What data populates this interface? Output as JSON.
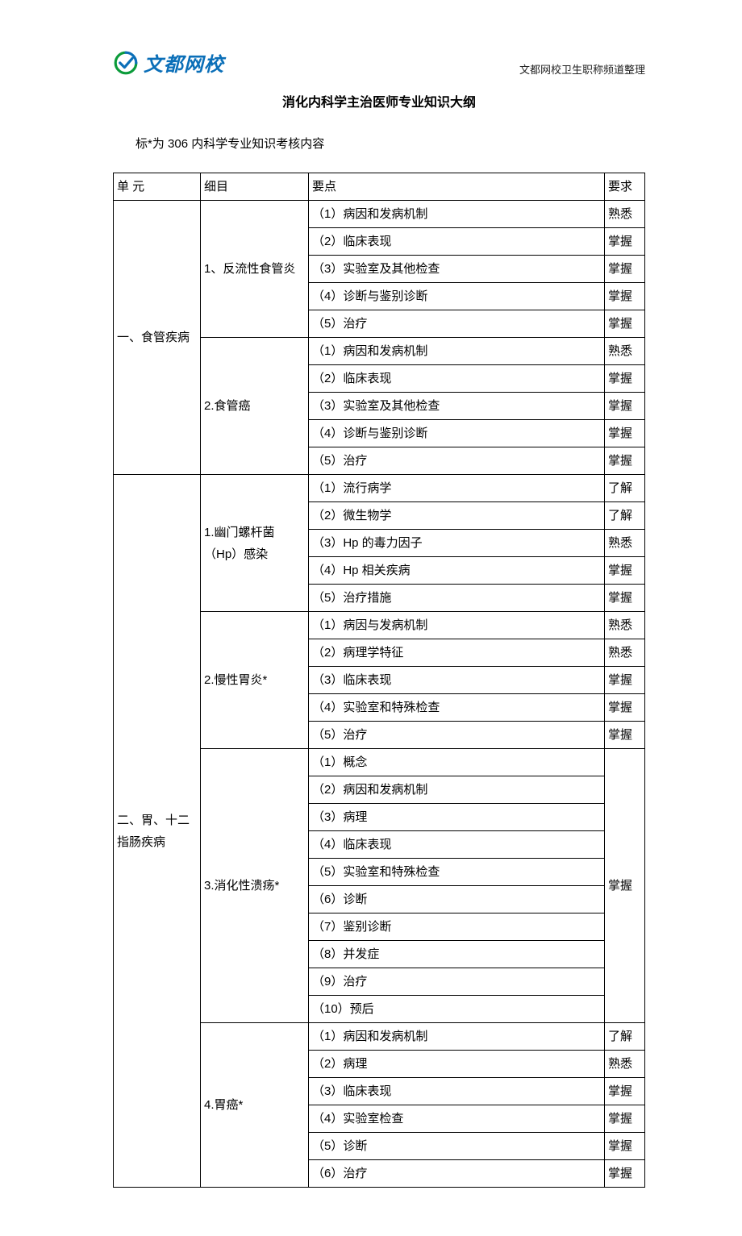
{
  "header_right": "文都网校卫生职称频道整理",
  "logo_text": "文都网校",
  "title": "消化内科学主治医师专业知识大纲",
  "note": "标*为 306 内科学专业知识考核内容",
  "columns": {
    "unit": "单 元",
    "detail": "细目",
    "point": "要点",
    "req": "要求"
  },
  "units": [
    {
      "name": "一、食管疾病",
      "details": [
        {
          "name": "1、反流性食管炎",
          "points": [
            {
              "text": "（1）病因和发病机制",
              "req": "熟悉"
            },
            {
              "text": "（2）临床表现",
              "req": "掌握"
            },
            {
              "text": "（3）实验室及其他检查",
              "req": "掌握"
            },
            {
              "text": "（4）诊断与鉴别诊断",
              "req": "掌握"
            },
            {
              "text": "（5）治疗",
              "req": "掌握"
            }
          ]
        },
        {
          "name": "2.食管癌",
          "points": [
            {
              "text": "（1）病因和发病机制",
              "req": "熟悉"
            },
            {
              "text": "（2）临床表现",
              "req": "掌握"
            },
            {
              "text": "（3）实验室及其他检查",
              "req": "掌握"
            },
            {
              "text": "（4）诊断与鉴别诊断",
              "req": "掌握"
            },
            {
              "text": "（5）治疗",
              "req": "掌握"
            }
          ]
        }
      ]
    },
    {
      "name": "二、胃、十二指肠疾病",
      "details": [
        {
          "name": "1.幽门螺杆菌（Hp）感染",
          "points": [
            {
              "text": "（1）流行病学",
              "req": "了解"
            },
            {
              "text": "（2）微生物学",
              "req": "了解"
            },
            {
              "text": "（3）Hp 的毒力因子",
              "req": "熟悉"
            },
            {
              "text": "（4）Hp 相关疾病",
              "req": "掌握"
            },
            {
              "text": "（5）治疗措施",
              "req": "掌握"
            }
          ]
        },
        {
          "name": "2.慢性胃炎*",
          "points": [
            {
              "text": "（1）病因与发病机制",
              "req": "熟悉"
            },
            {
              "text": "（2）病理学特征",
              "req": "熟悉"
            },
            {
              "text": "（3）临床表现",
              "req": "掌握"
            },
            {
              "text": "（4）实验室和特殊检查",
              "req": "掌握"
            },
            {
              "text": "（5）治疗",
              "req": "掌握"
            }
          ]
        },
        {
          "name": "3.消化性溃疡*",
          "merged_req": "掌握",
          "points": [
            {
              "text": "（1）概念"
            },
            {
              "text": "（2）病因和发病机制"
            },
            {
              "text": "（3）病理"
            },
            {
              "text": "（4）临床表现"
            },
            {
              "text": "（5）实验室和特殊检查"
            },
            {
              "text": "（6）诊断"
            },
            {
              "text": "（7）鉴别诊断"
            },
            {
              "text": "（8）并发症"
            },
            {
              "text": "（9）治疗"
            },
            {
              "text": "（10）预后"
            }
          ]
        },
        {
          "name": "4.胃癌*",
          "points": [
            {
              "text": "（1）病因和发病机制",
              "req": "了解"
            },
            {
              "text": "（2）病理",
              "req": "熟悉"
            },
            {
              "text": "（3）临床表现",
              "req": "掌握"
            },
            {
              "text": "（4）实验室检查",
              "req": "掌握"
            },
            {
              "text": "（5）诊断",
              "req": "掌握"
            },
            {
              "text": "（6）治疗",
              "req": "掌握"
            }
          ]
        }
      ]
    }
  ]
}
